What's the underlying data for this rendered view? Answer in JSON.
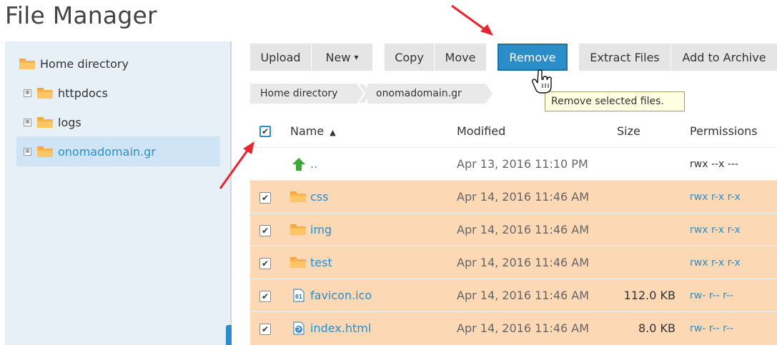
{
  "page": {
    "title": "File Manager"
  },
  "sidebar": {
    "items": [
      {
        "label": "Home directory"
      },
      {
        "label": "httpdocs",
        "expand": "⊞"
      },
      {
        "label": "logs",
        "expand": "⊞"
      },
      {
        "label": "onomadomain.gr",
        "expand": "⊞",
        "selected": true
      }
    ]
  },
  "toolbar": {
    "upload": "Upload",
    "new": "New",
    "new_caret": "▾",
    "copy": "Copy",
    "move": "Move",
    "remove": "Remove",
    "extract": "Extract Files",
    "archive": "Add to Archive"
  },
  "breadcrumb": {
    "items": [
      "Home directory",
      "onomadomain.gr"
    ]
  },
  "tooltip": {
    "text": "Remove selected files."
  },
  "table": {
    "headers": {
      "name": "Name",
      "sort_indicator": "▲",
      "modified": "Modified",
      "size": "Size",
      "permissions": "Permissions"
    },
    "select_all_checked": true,
    "rows": [
      {
        "name": "..",
        "modified": "Apr 13, 2016 11:10 PM",
        "size": "",
        "permissions": "rwx --x ---",
        "type": "parent",
        "checked": false
      },
      {
        "name": "css",
        "modified": "Apr 14, 2016 11:46 AM",
        "size": "",
        "permissions": "rwx r-x r-x",
        "type": "folder",
        "checked": true
      },
      {
        "name": "img",
        "modified": "Apr 14, 2016 11:46 AM",
        "size": "",
        "permissions": "rwx r-x r-x",
        "type": "folder",
        "checked": true
      },
      {
        "name": "test",
        "modified": "Apr 14, 2016 11:46 AM",
        "size": "",
        "permissions": "rwx r-x r-x",
        "type": "folder",
        "checked": true
      },
      {
        "name": "favicon.ico",
        "modified": "Apr 14, 2016 11:46 AM",
        "size": "112.0 KB",
        "permissions": "rw- r-- r--",
        "type": "binary-file",
        "checked": true
      },
      {
        "name": "index.html",
        "modified": "Apr 14, 2016 11:46 AM",
        "size": "8.0 KB",
        "permissions": "rw- r-- r--",
        "type": "html-file",
        "checked": true
      }
    ]
  },
  "icons": {
    "folder": "folder-icon",
    "parent": "up-arrow-icon",
    "binary": "binary-file-icon",
    "html": "html-file-icon",
    "cursor": "hand-cursor-icon",
    "arrow": "red-arrow-icon"
  },
  "colors": {
    "accent": "#2b8ec9",
    "selected_row": "#fcd8b5",
    "sidebar": "#e8f0f7",
    "arrow": "#e5262e"
  }
}
